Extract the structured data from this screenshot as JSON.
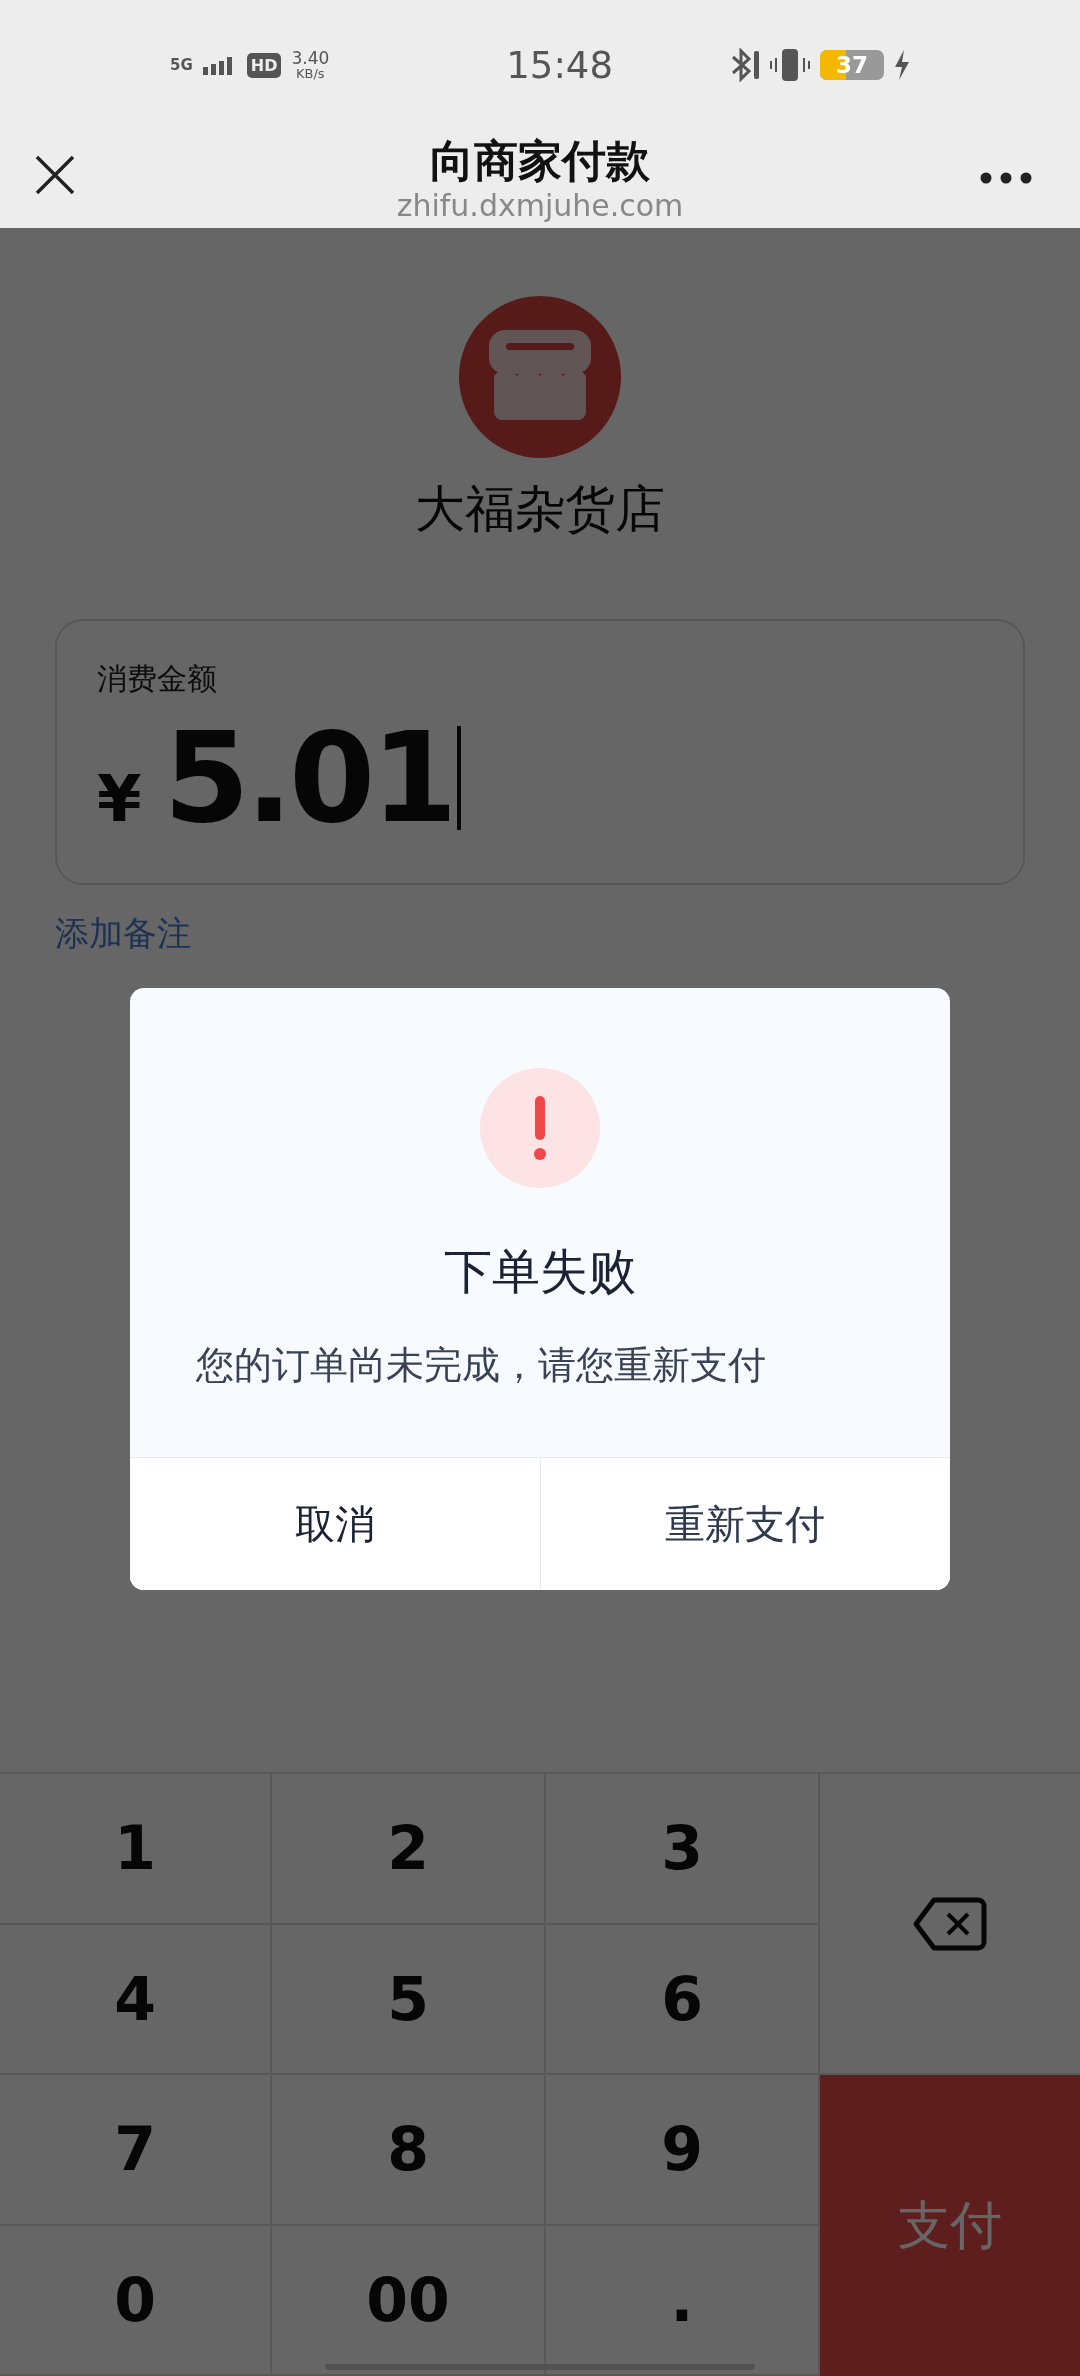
{
  "status_bar": {
    "network": "5G",
    "hd": "HD",
    "speed": "3.40",
    "speed_unit": "KB/s",
    "time": "15:48",
    "battery": "37"
  },
  "nav": {
    "title": "向商家付款",
    "url": "zhifu.dxmjuhe.com"
  },
  "store": {
    "name": "大福杂货店"
  },
  "amount": {
    "label": "消费金额",
    "currency": "¥",
    "value": "5.01"
  },
  "note_link": "添加备注",
  "dialog": {
    "title": "下单失败",
    "message": "您的订单尚未完成，请您重新支付",
    "buttons": [
      {
        "label": "取消"
      },
      {
        "label": "重新支付"
      }
    ]
  },
  "keypad": [
    {
      "kind": "digit",
      "label": "1"
    },
    {
      "kind": "digit",
      "label": "2"
    },
    {
      "kind": "digit",
      "label": "3"
    },
    {
      "kind": "backspace"
    },
    {
      "kind": "digit",
      "label": "4"
    },
    {
      "kind": "digit",
      "label": "5"
    },
    {
      "kind": "digit",
      "label": "6"
    },
    {
      "kind": "digit",
      "label": "7"
    },
    {
      "kind": "digit",
      "label": "8"
    },
    {
      "kind": "digit",
      "label": "9"
    },
    {
      "kind": "pay",
      "label": "支付"
    },
    {
      "kind": "digit",
      "label": "0"
    },
    {
      "kind": "digit",
      "label": "00"
    },
    {
      "kind": "digit",
      "label": "."
    }
  ]
}
